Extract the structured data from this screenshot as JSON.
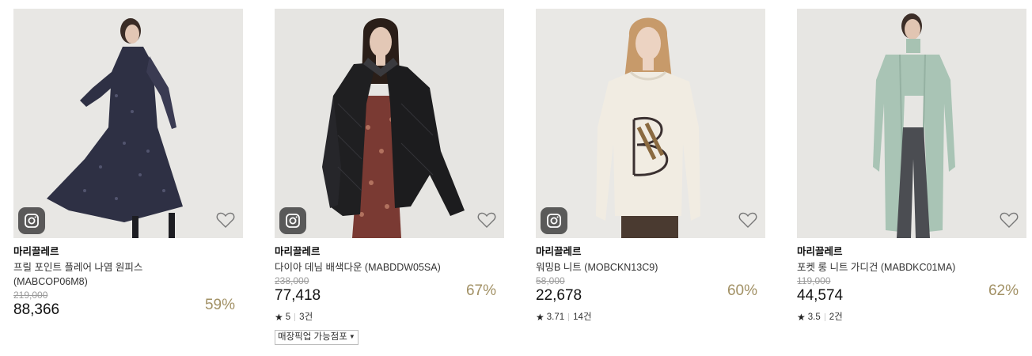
{
  "products": [
    {
      "brand": "마리끌레르",
      "name": "프릴 포인트 플레어 나염 원피스 (MABCOP06M8)",
      "original_price": "219,000",
      "sale_price": "88,366",
      "discount": "59%",
      "has_instagram": true,
      "photo_bg": "#e8e7e4"
    },
    {
      "brand": "마리끌레르",
      "name": "다이아 데님 배색다운 (MABDDW05SA)",
      "original_price": "238,000",
      "sale_price": "77,418",
      "discount": "67%",
      "rating": "5",
      "reviews": "3건",
      "pickup_label": "매장픽업 가능점포",
      "has_instagram": true,
      "photo_bg": "#e6e5e2"
    },
    {
      "brand": "마리끌레르",
      "name": "워밍B 니트 (MOBCKN13C9)",
      "original_price": "58,000",
      "sale_price": "22,678",
      "discount": "60%",
      "rating": "3.71",
      "reviews": "14건",
      "has_instagram": true,
      "photo_bg": "#e9e8e5"
    },
    {
      "brand": "마리끌레르",
      "name": "포켓 롱 니트 가디건 (MABDKC01MA)",
      "original_price": "119,000",
      "sale_price": "44,574",
      "discount": "62%",
      "rating": "3.5",
      "reviews": "2건",
      "has_instagram": false,
      "photo_bg": "#e7e6e3"
    }
  ],
  "icons": {
    "instagram": "instagram-icon",
    "wishlist": "heart-icon",
    "star": "★",
    "caret": "▼"
  },
  "colors": {
    "discount": "#a29165",
    "strike_price": "#9a9a9a"
  }
}
